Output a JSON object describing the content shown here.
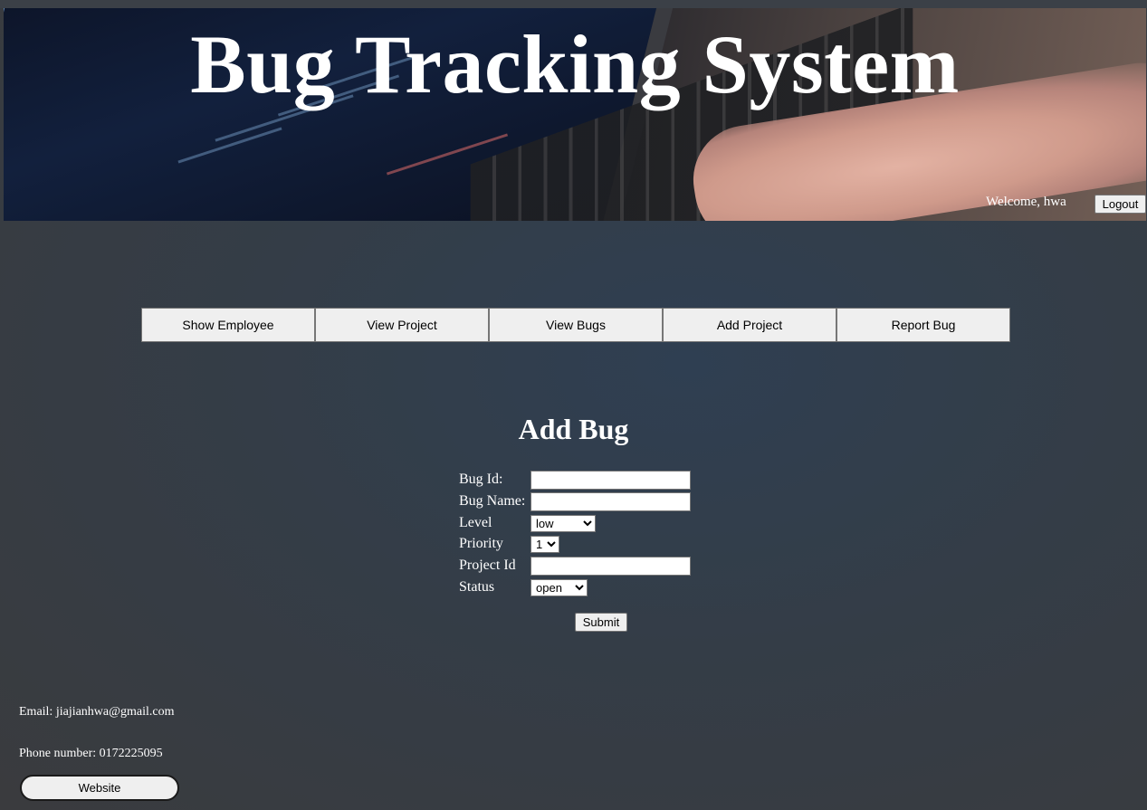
{
  "header": {
    "title": "Bug Tracking System",
    "welcome": "Welcome, hwa",
    "logout_label": "Logout"
  },
  "nav": {
    "items": [
      {
        "label": "Show Employee"
      },
      {
        "label": "View Project"
      },
      {
        "label": "View Bugs"
      },
      {
        "label": "Add Project"
      },
      {
        "label": "Report Bug"
      }
    ]
  },
  "form": {
    "title": "Add Bug",
    "bug_id": {
      "label": "Bug Id:",
      "value": ""
    },
    "bug_name": {
      "label": "Bug Name:",
      "value": ""
    },
    "level": {
      "label": "Level",
      "selected": "low"
    },
    "priority": {
      "label": "Priority",
      "selected": "1"
    },
    "project_id": {
      "label": "Project Id",
      "value": ""
    },
    "status": {
      "label": "Status",
      "selected": "open"
    },
    "submit_label": "Submit"
  },
  "footer": {
    "email": "Email: jiajianhwa@gmail.com",
    "phone": "Phone number: 0172225095",
    "website_label": "Website"
  }
}
